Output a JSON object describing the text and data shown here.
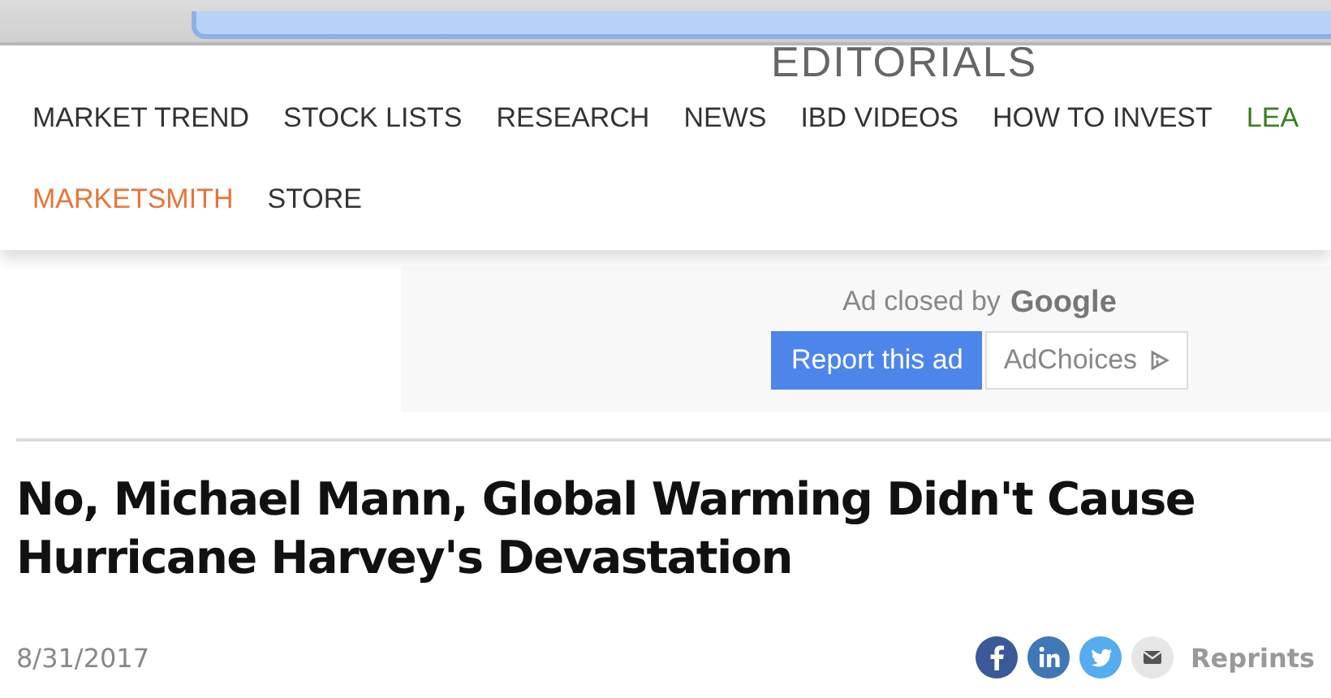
{
  "section_title": "EDITORIALS",
  "nav_rows": [
    [
      {
        "label": "MARKET TREND",
        "color": "#333333"
      },
      {
        "label": "STOCK LISTS",
        "color": "#333333"
      },
      {
        "label": "RESEARCH",
        "color": "#333333"
      },
      {
        "label": "NEWS",
        "color": "#333333"
      },
      {
        "label": "IBD VIDEOS",
        "color": "#333333"
      },
      {
        "label": "HOW TO INVEST",
        "color": "#333333"
      },
      {
        "label": "LEA",
        "color": "#3a7d1e"
      }
    ],
    [
      {
        "label": "MARKETSMITH",
        "color": "#e8743b"
      },
      {
        "label": "STORE",
        "color": "#333333"
      }
    ]
  ],
  "ad": {
    "message": "Ad closed by",
    "brand": "Google",
    "report_button": "Report this ad",
    "choices_button": "AdChoices"
  },
  "headline": "No, Michael Mann, Global Warming Didn't Cause Hurricane Harvey's Devastation",
  "date": "8/31/2017",
  "reprints_link": "Reprints"
}
